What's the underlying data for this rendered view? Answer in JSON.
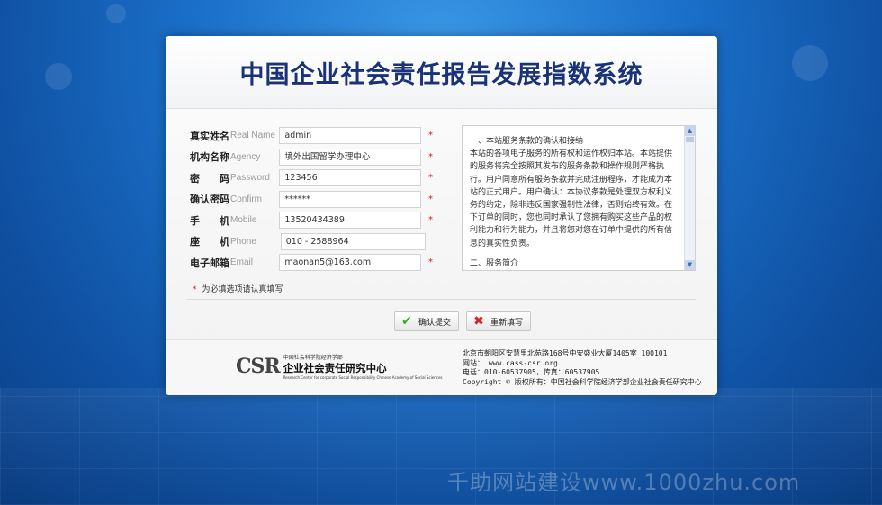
{
  "page": {
    "site_title": "中国企业社会责任报告发展指数系统",
    "watermark": "千助网站建设www.1000zhu.com"
  },
  "form": {
    "fields": [
      {
        "label_cn": "真实姓名",
        "label_en": "Real Name",
        "value": "admin",
        "required": "*"
      },
      {
        "label_cn": "机构名称",
        "label_en": "Agency",
        "value": "境外出国留学办理中心",
        "required": "*"
      },
      {
        "label_cn": "密　　码",
        "label_en": "Password",
        "value": "123456",
        "required": "*"
      },
      {
        "label_cn": "确认密码",
        "label_en": "Confirm",
        "value": "******",
        "required": "*"
      },
      {
        "label_cn": "手　　机",
        "label_en": "Mobile",
        "value": "13520434389",
        "required": "*"
      },
      {
        "label_cn": "座　　机",
        "label_en": "Phone",
        "value": "010 - 2588964",
        "required": ""
      },
      {
        "label_cn": "电子邮箱",
        "label_en": "Email",
        "value": "maonan5@163.com",
        "required": "*"
      }
    ],
    "required_note": "为必填选项请认真填写",
    "required_note_star": "*"
  },
  "terms": {
    "paragraphs": [
      "一、本站服务条款的确认和接纳",
      "本站的各项电子服务的所有权和运作权归本站。本站提供的服务将完全按照其发布的服务条款和操作规则严格执行。用户同意所有服务条款并完成注册程序，才能成为本站的正式用户。用户确认：本协议条款是处理双方权利义务的约定，除非违反国家强制性法律，否则始终有效。在下订单的同时，您也同时承认了您拥有购买这些产品的权利能力和行为能力，并且将您对您在订单中提供的所有信息的真实性负责。",
      "二、服务简介"
    ]
  },
  "buttons": {
    "submit_label": "确认提交",
    "reset_label": "重新填写"
  },
  "footer": {
    "logo_mark": "CSR",
    "logo_top": "中国社会科学院经济学部",
    "logo_main": "企业社会责任研究中心",
    "logo_en": "Research Center for corporate Social Responsibility Chinese Academy of Social Sciences",
    "address": "北京市朝阳区安慧里北苑路168号中安盛业大厦1405室  100101",
    "website": "网站：  www.cass-csr.org",
    "phone": "电话：010-60537905，传真：60537905",
    "copyright": "Copyright © 版权所有：中国社会科学院经济学部企业社会责任研究中心"
  },
  "icons": {
    "submit": "checkmark-icon",
    "reset": "cross-icon"
  }
}
